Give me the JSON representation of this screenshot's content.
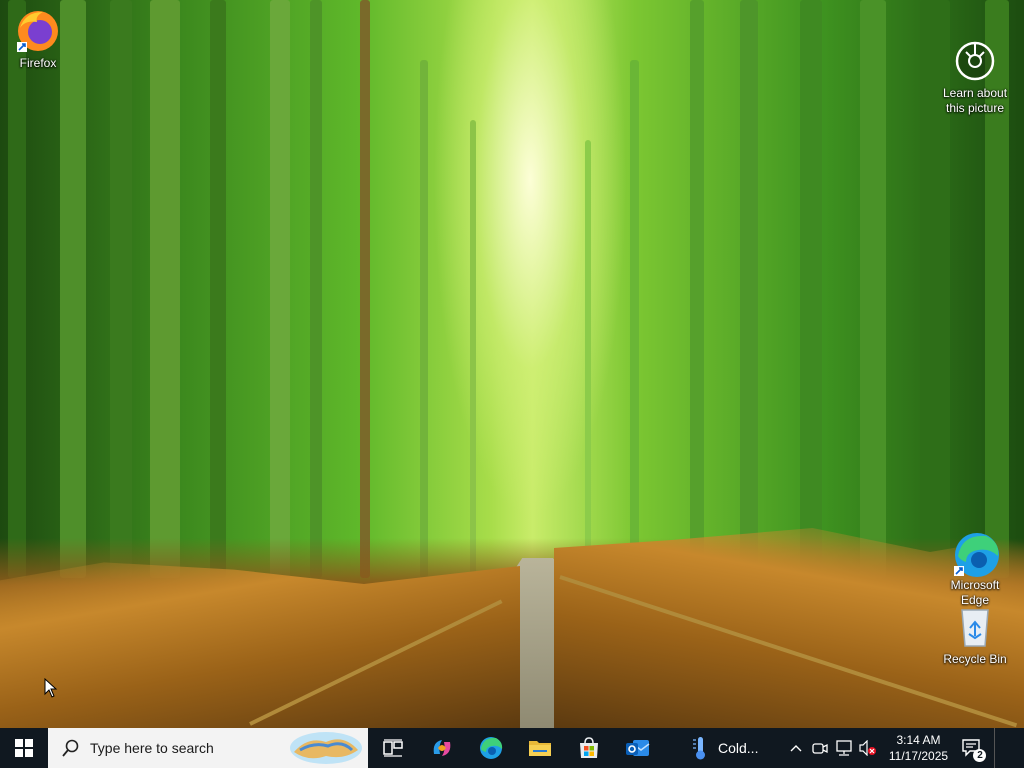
{
  "desktop": {
    "icons": [
      {
        "label": "Firefox",
        "icon": "firefox-icon"
      },
      {
        "label": "Learn about\nthis picture",
        "icon": "camera-icon"
      },
      {
        "label": "Microsoft\nEdge",
        "icon": "edge-icon"
      },
      {
        "label": "Recycle Bin",
        "icon": "recycle-bin-icon"
      }
    ]
  },
  "taskbar": {
    "search_placeholder": "Type here to search",
    "apps": [
      {
        "name": "Task View",
        "icon": "task-view-icon"
      },
      {
        "name": "Copilot",
        "icon": "copilot-icon"
      },
      {
        "name": "Microsoft Edge",
        "icon": "edge-icon"
      },
      {
        "name": "File Explorer",
        "icon": "folder-icon"
      },
      {
        "name": "Microsoft Store",
        "icon": "store-icon"
      },
      {
        "name": "Outlook",
        "icon": "outlook-icon"
      }
    ],
    "weather_text": "Cold...",
    "time": "3:14 AM",
    "date": "11/17/2025",
    "notification_count": "2"
  },
  "colors": {
    "taskbar_bg": "#101820",
    "search_bg": "#f3f3f3",
    "accent_blue": "#0078d4"
  }
}
